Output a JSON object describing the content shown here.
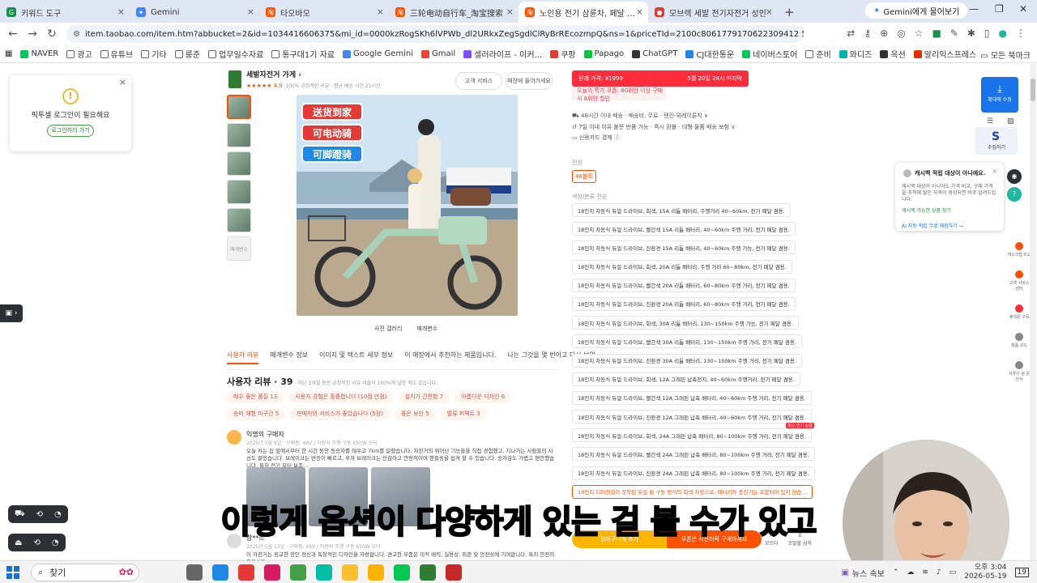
{
  "tabs": [
    {
      "label": "키워드 도구",
      "color": "#1a8f4c"
    },
    {
      "label": "Gemini",
      "color": "#4285f4"
    },
    {
      "label": "타오바오",
      "color": "#ff5000"
    },
    {
      "label": "三轮电动自行车_淘宝搜索",
      "color": "#ff5000"
    },
    {
      "label": "노인용 전기 삼륜차, 페달 보조",
      "color": "#ff5000"
    },
    {
      "label": "모브렉 세발 전기자전거 성인",
      "color": "#e53935"
    }
  ],
  "gemini_button": "Gemini에게 물어보기",
  "url": "item.taobao.com/item.htm?abbucket=2&id=1034416606375&mi_id=0000kzRogSKh6lVPWb_dl2URkxZegSgdlClRyBrREcozmpQ&ns=1&priceTId=2100c8061779170622309412 5e0cd8&skuId=6049895564787&...",
  "bookmarks": [
    "NAVER",
    "광고",
    "유튜브",
    "기타",
    "룽준",
    "업무일수자료",
    "통구대1기 자료",
    "Google Gemini",
    "Gmail",
    "셀러라이프 - 이커...",
    "쿠팡",
    "Papago",
    "ChatGPT",
    "CJ대한통운",
    "네이버스토어",
    "준비",
    "와디즈",
    "옥션",
    "알리익스프레스"
  ],
  "bookmarks_all": "모든 북마크",
  "login_popup": {
    "message": "픽투셀 로그인이 필요해요",
    "button": "로그인하러 가기"
  },
  "store": {
    "name": "세발자전거 가게",
    "rating": "4.9",
    "meta": "100% 긍정적인 리뷰 · 평균 배송 시간 21시간",
    "btn1": "고객 서비스",
    "btn2": "매장에 들어가세요"
  },
  "main_image": {
    "tags": [
      "送货到家",
      "可电动骑",
      "可脚蹬骑"
    ]
  },
  "thumbs_more": "애개변수",
  "image_tabs": [
    "사진 갤러리",
    "매개변수"
  ],
  "detail_tabs": [
    "사용자 리뷰",
    "매개변수 정보",
    "이미지 및 텍스트 세부 정보",
    "이 매장에서 추천하는 제품입니다.",
    "나는 그것을 몇 번이고 다시 보았"
  ],
  "reviews": {
    "title": "사용자 리뷰 · 39",
    "subtitle": "지난 3개월 동안 긍정적인 리뷰 비율이 100%에 달한 적도 있습니다.",
    "chips": [
      "매우 좋은 품질 13",
      "사용자 경험은 훌륭합니다 (10점 만점)",
      "설치가 간편함 7",
      "아름다운 디자인 6",
      "승마 체험 마구간 5",
      "판매자의 서비스가 좋았습니다 (5점)",
      "좋은 보안 5",
      "밸류 퍼펙트 3"
    ],
    "items": [
      {
        "name": "익명의 구매자",
        "meta": "2025년 3월 8일 · 구매품: 48V / 차량의 주행 구동 650W 모터",
        "text": "오늘 저는 집 앞에서부터 한 시간 동안 동승자를 태우고 7km를 달렸습니다. 자전거의 뛰어난 기능들을 직접 경험했고, 지나가는 사람들의 시선도 끌었습니다. 브레이크는 반응이 빠르고, 후자 브레이크는 민감하고 안정적이며 핸들링을 쉽게 할 수 있습니다. 승차감도 가볍고 편안했습니다. 특히 전기 모터 보조..."
      },
      {
        "name": "창**르",
        "meta": "2025년 5월 13일 · 구매품: 48V / 차량의 주행 구동 650W 모터",
        "text": "이 자전거는 정교한 장인 정신과 독창적인 디자인을 자랑합니다. 견고한 부품은 미적 매력, 실용성, 외관 및 안전성에 기여합니다. 특히 안전의 최우선인"
      }
    ]
  },
  "pricebar": {
    "left": "원래 가격: ¥1999",
    "right": "5월 20일 24시 마지막"
  },
  "coupon": "오늘의 특가 쿠폰: 80위안 이상 구매 시 8위안 할인",
  "ship": [
    "48시간 이내 배송 · 배송비: 무료 · 텐진-위레이룬지 ∨",
    "7일 이내 이유 불문 반품 가능 · 즉시 환불 · 대형 물품 배송 보험 ∨",
    "신용카드 결제 ⓘ"
  ],
  "option_labels": {
    "battery": "전원",
    "color": "색상/분류 전원"
  },
  "selected_battery": "48볼트",
  "options": [
    "18인치 차동식 듀얼 드라이브, 회색, 15A 리튬 배터리, 주행거리 40~60km, 전기 페달 겸용.",
    "18인치 차동식 듀얼 드라이브, 빨간색 15A 리튬 배터리, 40~60km 주행 거리, 전기 페달 겸용.",
    "18인치 차동식 듀얼 드라이브, 진환경 15A 리튬 배터리, 40~60km 주행 가능, 전기 페달 겸용.",
    "18인치 차동식 듀얼 드라이브, 회색, 20A 리튬 배터리, 주행 거리 60~80km, 전기 페달 겸용.",
    "18인치 차동식 듀얼 드라이브, 빨간색 20A 리튬 배터리, 60~80km 주행 거리, 전기 페달 겸용.",
    "18인치 차동식 듀얼 드라이브, 진환경 20A 리튬 배터리, 60~80km 주행 거리, 전기 페달 겸용.",
    "18인치 차동식 듀얼 드라이브, 회색, 30A 리튬 배터리, 130~150km 주행 가능, 전기 페달 겸용.",
    "18인치 차동식 듀얼 드라이브, 빨간색 30A 리튬 배터리, 130~150km 주행 거리, 전기 페달 겸용.",
    "18인치 차동식 듀얼 드라이브, 진환경 30A 리튬 배터리, 130~150km 주행 거리, 전기 페달 겸용.",
    "18인치 차동식 듀얼 드라이브, 회색, 12A 그래핀 납축전지, 40~60km 주행거리, 전기 페달 겸용.",
    "18인치 차동식 듀얼 드라이브, 빨간색 12A 그래핀 납축 배터리, 40~60km 주행 거리, 전기 페달 겸용.",
    "18인치 차동식 듀얼 드라이브, 진환경 12A 그래핀 납축 배터리, 40~60km 주행 거리, 전기 페달 겸용.",
    "18인치 차동식 듀얼 드라이브, 회색, 24A 그래핀 납축 배터리, 80~100km 주행 거리, 전기 페달 겸용.",
    "18인치 차동식 듀얼 드라이브, 빨간색 24A 그래핀 납축 배터리, 80~100km 주행 거리, 전기 페달 겸용.",
    "18인치 차동식 듀얼 드라이브, 진환경 24A 그래핀 납축 배터리, 80~100km 주행 거리, 전기 페달 겸용.",
    "18인치 디퍼렌셜이 장착된 듀얼 휠 구동 방식의 회색 차량으로, 배터리와 충전기는 포함되어 있지 않습..."
  ],
  "option_badge": "최근 인기 상품",
  "buy": {
    "cart": "장바구니에 추가",
    "coupon": "쿠폰은 사전허락 구매하세요"
  },
  "buy_icons": [
    "모으다",
    "조발할 삼자"
  ],
  "collect": {
    "btn": "확대해 수집",
    "btn2": "수집하기"
  },
  "cashback": {
    "title": "캐시백 적립 대상이 아니에요.",
    "body": "캐시백 대상이 아니어도 가격 비교, 구매 가격을 추적해 할인 자격이 생성되면 바로 알려드립니다.",
    "link": "캐시백 가능한 상품 찾기",
    "link2": "AI 자동 적립 무료 체험하기 →"
  },
  "rail": [
    "재스크랩 비교",
    "고객 서비스 센터",
    "휴대폰 구독",
    "제품 코드",
    "서류이 검 운전사"
  ],
  "caption": "이렇게 옵션이 다양하게 있는 걸 볼 수가 있고",
  "taskbar": {
    "search": "찾기",
    "news": "뉴스 속보",
    "time": "오후 3:04",
    "date": "2026-05-19"
  }
}
